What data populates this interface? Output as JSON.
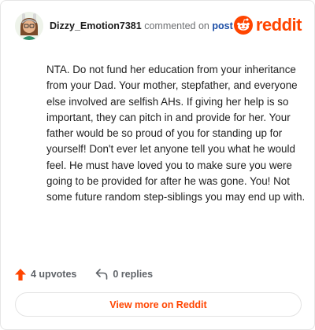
{
  "comment": {
    "username": "Dizzy_Emotion7381",
    "commented_text": "commented on",
    "post_link": "post",
    "brand_wordmark": "reddit",
    "body": "NTA. Do not fund her education from your inheritance from your Dad. Your mother, stepfather, and everyone else involved are selfish AHs. If giving her help is so important, they can pitch in and provide for her. Your father would be so proud of you for standing up for yourself! Don't ever let anyone tell you what he would feel. He must have loved you to make sure you were going to be provided for after he was gone. You! Not some future random step-siblings you may end up with.",
    "upvotes": "4 upvotes",
    "replies": "0 replies",
    "view_more": "View more on Reddit"
  },
  "icons": {
    "avatar": "avatar-icon",
    "brand": "reddit-logo-icon",
    "upvote": "upvote-arrow-icon",
    "reply": "reply-arrow-icon"
  },
  "colors": {
    "brand": "#ff4500",
    "link": "#1c4ea6",
    "muted": "#5f6368"
  }
}
